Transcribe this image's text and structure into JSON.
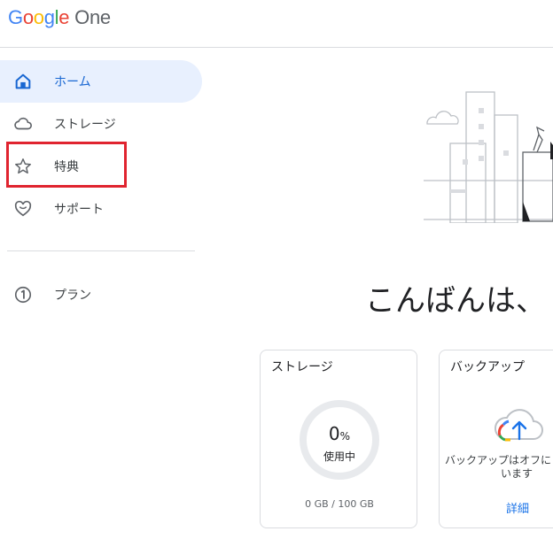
{
  "app": {
    "logo_parts": [
      "G",
      "o",
      "o",
      "g",
      "l",
      "e"
    ],
    "logo_suffix": "One"
  },
  "sidebar": {
    "items": [
      {
        "label": "ホーム",
        "icon": "home-icon",
        "active": true
      },
      {
        "label": "ストレージ",
        "icon": "cloud-icon",
        "active": false
      },
      {
        "label": "特典",
        "icon": "star-icon",
        "active": false
      },
      {
        "label": "サポート",
        "icon": "heart-support-icon",
        "active": false
      },
      {
        "label": "プラン",
        "icon": "google-one-plan-icon",
        "active": false
      }
    ],
    "highlight_color": "#e0242f",
    "active_color": "#1967d2"
  },
  "main": {
    "greeting": "こんばんは、",
    "storage_card": {
      "title": "ストレージ",
      "percent": "0",
      "percent_unit": "%",
      "used_label": "使用中",
      "quota": "0 GB / 100 GB",
      "usage_fraction": 0
    },
    "backup_card": {
      "title": "バックアップ",
      "status_line1": "バックアップはオフに",
      "status_line2": "います",
      "details_link": "詳細"
    }
  }
}
